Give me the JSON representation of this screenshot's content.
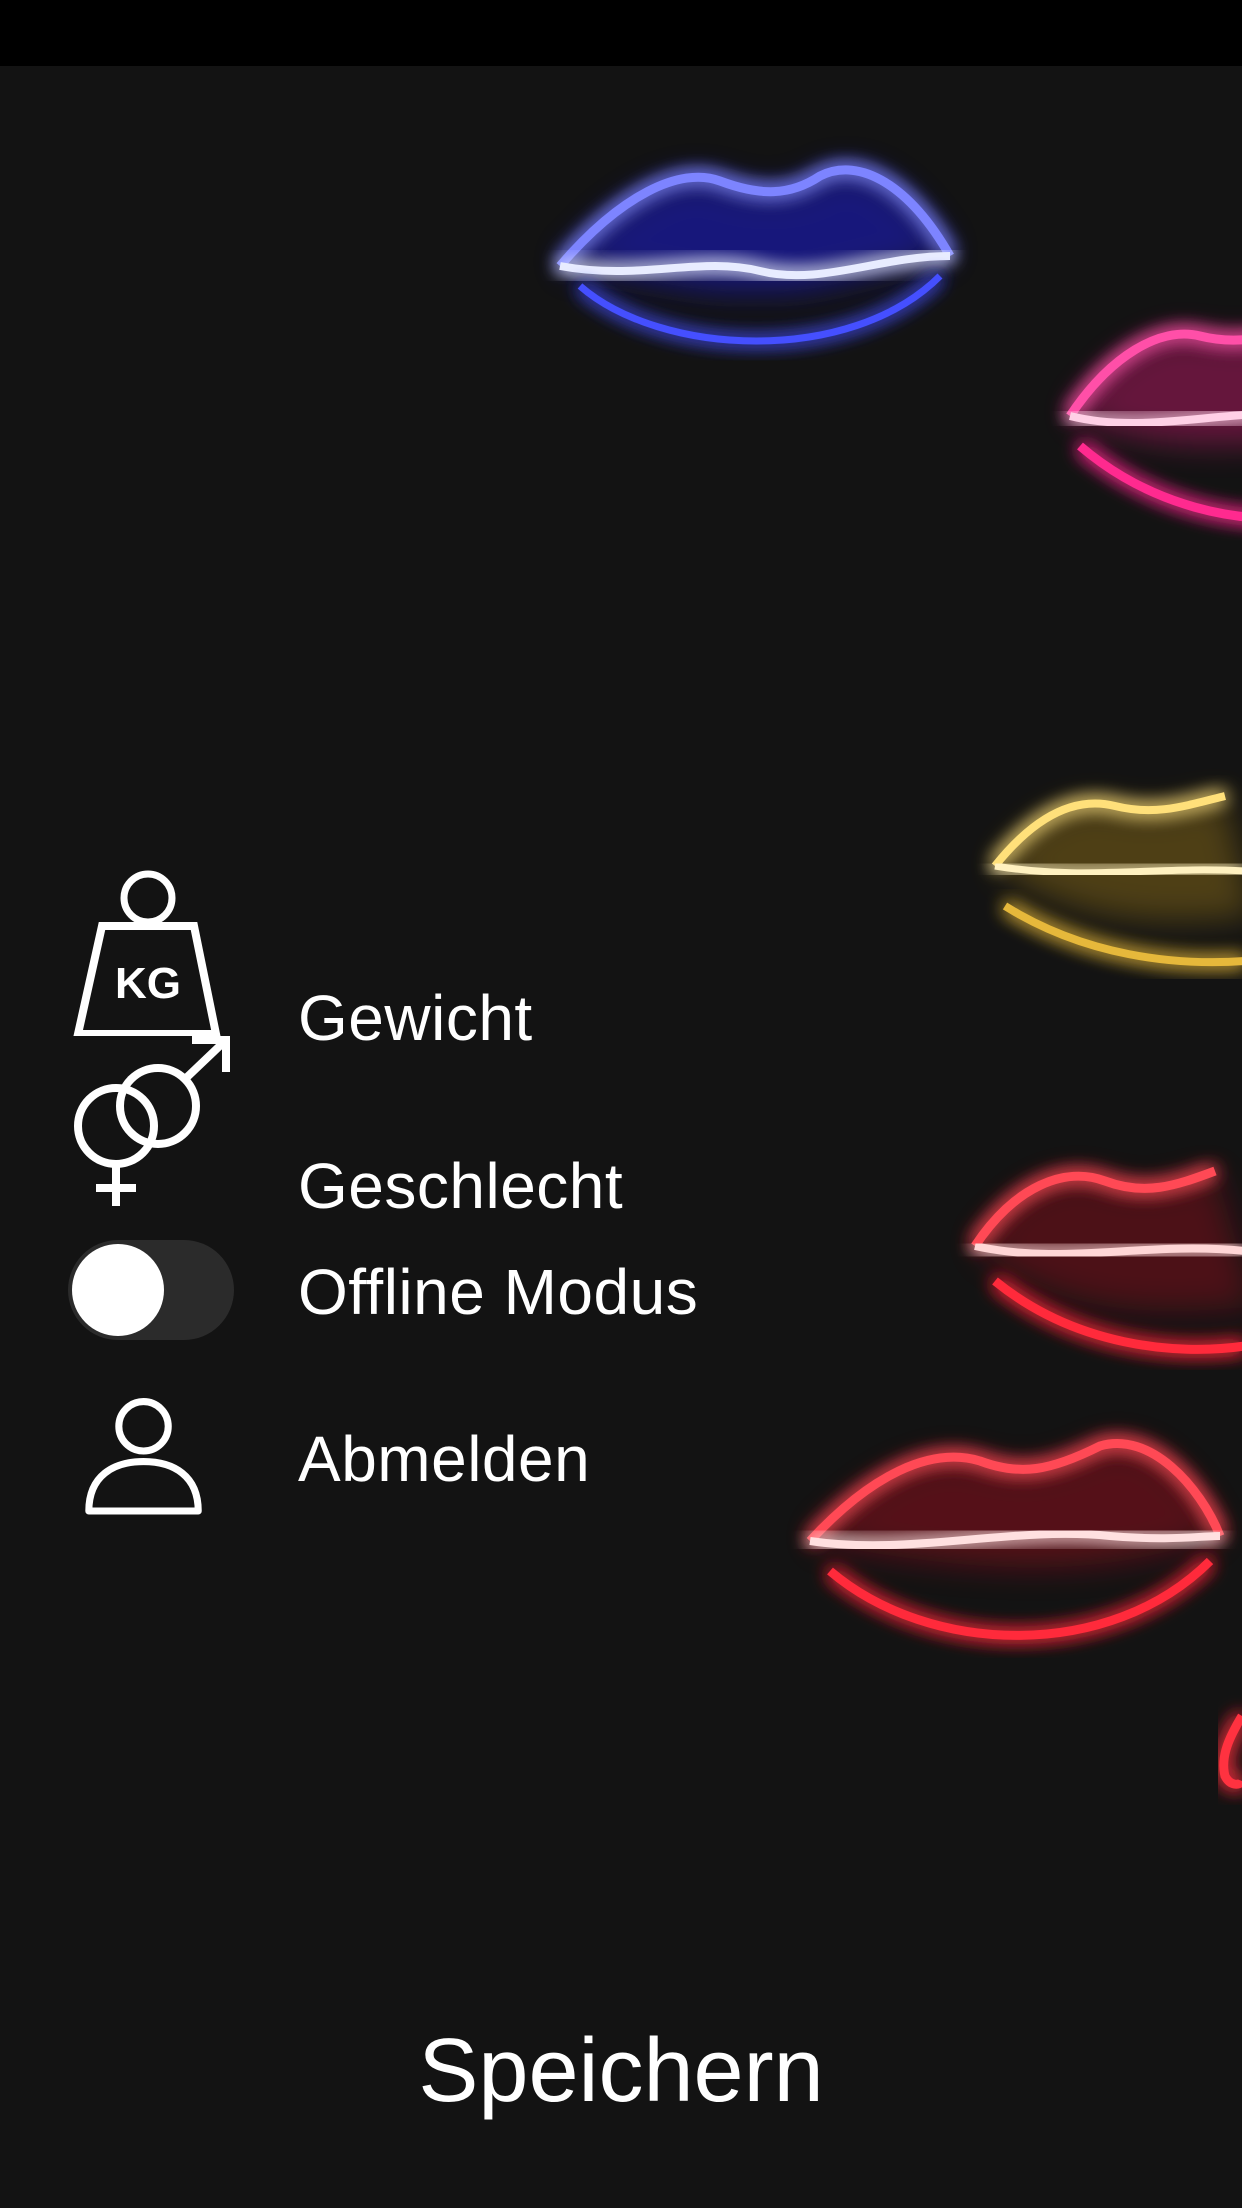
{
  "menu": {
    "items": [
      {
        "id": "weight",
        "label": "Gewicht",
        "icon": "weight-kg-icon",
        "icon_text": "KG"
      },
      {
        "id": "gender",
        "label": "Geschlecht",
        "icon": "gender-symbols-icon"
      },
      {
        "id": "offline",
        "label": "Offline Modus",
        "icon": "toggle-switch",
        "toggle_on": false
      },
      {
        "id": "logout",
        "label": "Abmelden",
        "icon": "user-icon"
      }
    ]
  },
  "footer": {
    "save_label": "Speichern"
  },
  "colors": {
    "background": "#131313",
    "status_bar": "#000000",
    "text": "#ffffff",
    "toggle_track": "#2b2b2b",
    "neon_blue": "#3a44ff",
    "neon_pink": "#ff1f8a",
    "neon_yellow": "#ffd75a",
    "neon_red": "#ff2a3a"
  },
  "background_image": "neon-lips-image"
}
